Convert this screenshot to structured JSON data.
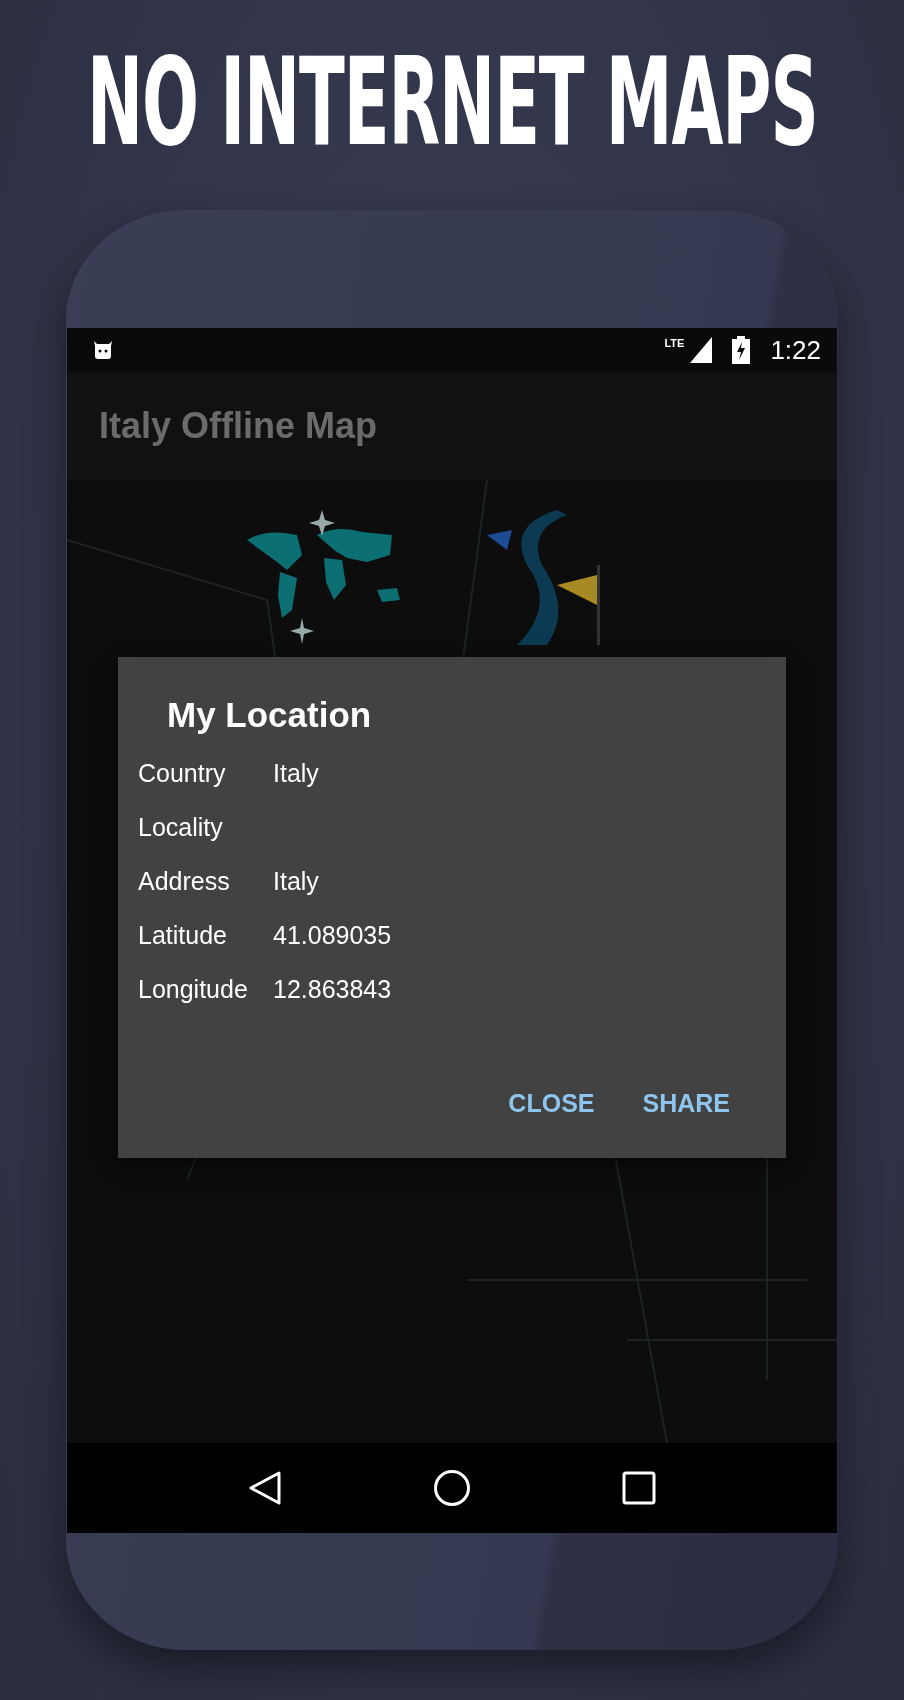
{
  "headline": "NO INTERNET MAPS",
  "status_bar": {
    "network": "LTE",
    "time": "1:22"
  },
  "app_bar": {
    "title": "Italy Offline Map"
  },
  "dialog": {
    "title": "My Location",
    "rows": [
      {
        "label": "Country",
        "value": "Italy"
      },
      {
        "label": "Locality"
      },
      {
        "label": "Address",
        "value": "Italy"
      },
      {
        "label": "Latitude",
        "value": "41.089035"
      },
      {
        "label": "Longitude",
        "value": "12.863843"
      }
    ],
    "buttons": [
      "CLOSE",
      "SHARE"
    ]
  }
}
